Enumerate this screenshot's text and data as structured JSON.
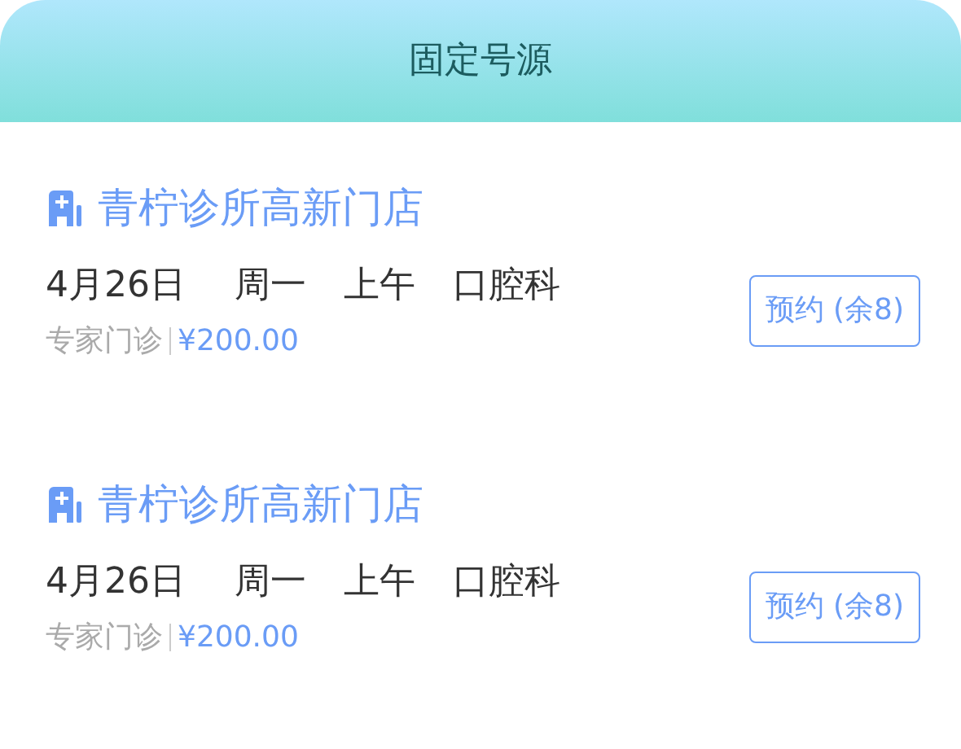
{
  "header": {
    "title": "固定号源"
  },
  "slots": [
    {
      "clinic": "青柠诊所高新门店",
      "date": "4月26日",
      "weekday": "周一",
      "period": "上午",
      "department": "口腔科",
      "type": "专家门诊",
      "price": "¥200.00",
      "button": "预约 (余8)"
    },
    {
      "clinic": "青柠诊所高新门店",
      "date": "4月26日",
      "weekday": "周一",
      "period": "上午",
      "department": "口腔科",
      "type": "专家门诊",
      "price": "¥200.00",
      "button": "预约 (余8)"
    }
  ]
}
